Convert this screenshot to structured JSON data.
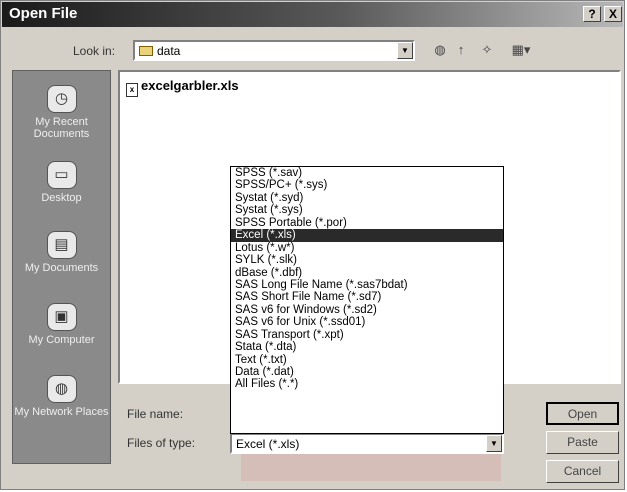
{
  "dialog": {
    "title": "Open File",
    "help_glyph": "?",
    "close_glyph": "X"
  },
  "lookin": {
    "label": "Look in:",
    "value": "data"
  },
  "places": [
    {
      "label": "My Recent Documents",
      "icon": "recent-documents-icon",
      "glyph": "◷"
    },
    {
      "label": "Desktop",
      "icon": "desktop-icon",
      "glyph": "▭"
    },
    {
      "label": "My Documents",
      "icon": "my-documents-icon",
      "glyph": "▤"
    },
    {
      "label": "My Computer",
      "icon": "my-computer-icon",
      "glyph": "▣"
    },
    {
      "label": "My Network Places",
      "icon": "network-places-icon",
      "glyph": "◍"
    }
  ],
  "files": [
    {
      "name": "excelgarbler.xls",
      "icon": "xls-file-icon"
    }
  ],
  "filename": {
    "label": "File name:",
    "value": ""
  },
  "filetype": {
    "label": "Files of type:",
    "value": "Excel (*.xls)",
    "options": [
      "SPSS (*.sav)",
      "SPSS/PC+ (*.sys)",
      "Systat (*.syd)",
      "Systat (*.sys)",
      "SPSS Portable (*.por)",
      "Excel (*.xls)",
      "Lotus (*.w*)",
      "SYLK (*.slk)",
      "dBase (*.dbf)",
      "SAS Long File Name (*.sas7bdat)",
      "SAS Short File Name (*.sd7)",
      "SAS v6 for Windows (*.sd2)",
      "SAS v6 for Unix (*.ssd01)",
      "SAS Transport (*.xpt)",
      "Stata (*.dta)",
      "Text (*.txt)",
      "Data (*.dat)",
      "All Files (*.*)"
    ],
    "selected_index": 5
  },
  "buttons": {
    "open": "Open",
    "paste": "Paste",
    "cancel": "Cancel"
  }
}
